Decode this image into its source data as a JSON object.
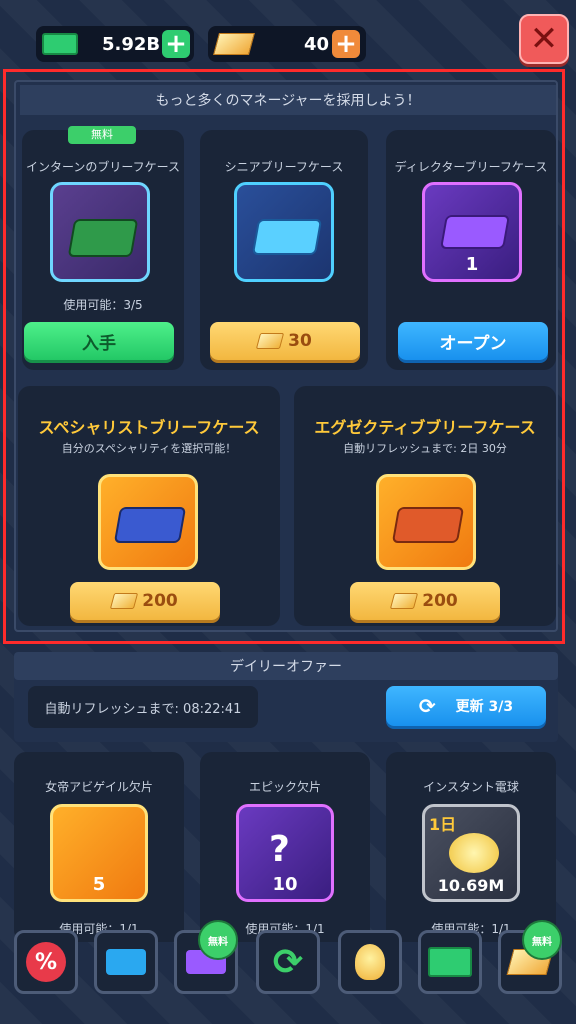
{
  "currency": {
    "cash": "5.92B",
    "gold": "40"
  },
  "panel": {
    "header": "もっと多くのマネージャーを採用しよう！",
    "intern": {
      "badge": "無料",
      "title": "インターンのブリーフケース",
      "availability": "使用可能：3/5",
      "button": "入手"
    },
    "senior": {
      "title": "シニアブリーフケース",
      "button": "30"
    },
    "director": {
      "title": "ディレクターブリーフケース",
      "count": "1",
      "button": "オープン"
    },
    "specialist": {
      "title": "スペシャリストブリーフケース",
      "subtitle": "自分のスペシャリティを選択可能！",
      "button": "200"
    },
    "executive": {
      "title": "エグゼクティブブリーフケース",
      "subtitle": "自動リフレッシュまで: 2日 30分",
      "button": "200"
    }
  },
  "daily": {
    "header": "デイリーオファー",
    "timer": "自動リフレッシュまで:  08:22:41",
    "refresh_button": "更新 3/3",
    "offers": [
      {
        "title": "女帝アビゲイル欠片",
        "count": "5",
        "availability": "使用可能：1/1"
      },
      {
        "title": "エピック欠片",
        "count": "10",
        "availability": "使用可能：1/1"
      },
      {
        "title": "インスタント電球",
        "corner": "1日",
        "count": "10.69M",
        "availability": "使用可能：1/1"
      }
    ]
  },
  "nav": {
    "free_label": "無料"
  },
  "colors": {
    "cash_green": "#2ecc71",
    "gold_accent": "#f2b740",
    "close_red": "#f05a5a",
    "highlight_red": "#ff2b2b"
  }
}
